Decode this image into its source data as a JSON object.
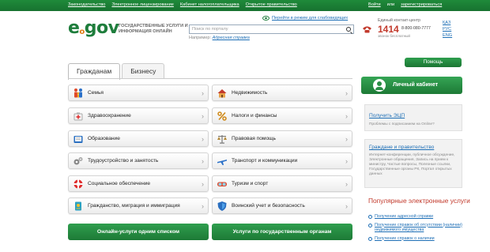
{
  "topbar": {
    "links": [
      "Законодательство",
      "Электронное лицензирование",
      "Кабинет налогоплательщика",
      "Открытое правительство"
    ],
    "login": "Войти",
    "or": "или",
    "register": "зарегистрироваться"
  },
  "header": {
    "logo_e": "e",
    "logo_dot": "o",
    "logo_gov": "gov",
    "tagline": "Государственные услуги и информация онлайн",
    "impaired_link": "Перейти в режим для слабовидящих",
    "search_placeholder": "Поиск по порталу",
    "example_label": "Например:",
    "example_link": "Адресная справка",
    "contact_title": "Единый контакт-центр",
    "contact_short": "1414",
    "contact_short_sub": "звонок бесплатный",
    "contact_number": "8-800-080-7777",
    "languages": [
      "ҚАЗ",
      "РУС",
      "ENG"
    ]
  },
  "tabs": [
    "Гражданам",
    "Бизнесу"
  ],
  "categories_left": [
    "Семья",
    "Здравоохранение",
    "Образование",
    "Трудоустройство и занятость",
    "Социальное обеспечение",
    "Гражданство, миграция и иммиграция"
  ],
  "categories_right": [
    "Недвижимость",
    "Налоги и финансы",
    "Правовая помощь",
    "Транспорт и коммуникации",
    "Туризм и спорт",
    "Воинский учет и безопасность"
  ],
  "buttons": {
    "all_services": "Онлайн-услуги одним списком",
    "by_agency": "Услуги по государственным органам"
  },
  "sidebar": {
    "help": "Помощь",
    "cabinet": "Личный кабинет",
    "eds_title": "Получить ЭЦП",
    "eds_text": "Проблемы с подписанием на Online?",
    "gov_title": "Граждане и правительство",
    "gov_text": "Интернет-конференции, публичное обсуждение, Электронные обращения, Запись на прием к министру, Частые вопросы, Полезные ссылки, Государственные органы РК, Портал открытых данных",
    "popular_title": "Популярные электронные услуги",
    "popular": [
      "Получение адресной справки",
      "Получение справок об отсутствии (наличии) недвижимого имущества",
      "Получение справок о наличии"
    ]
  },
  "colors": {
    "brand_green": "#1e7d3c",
    "accent_red": "#c23a2c",
    "link_blue": "#1e6fb6"
  }
}
